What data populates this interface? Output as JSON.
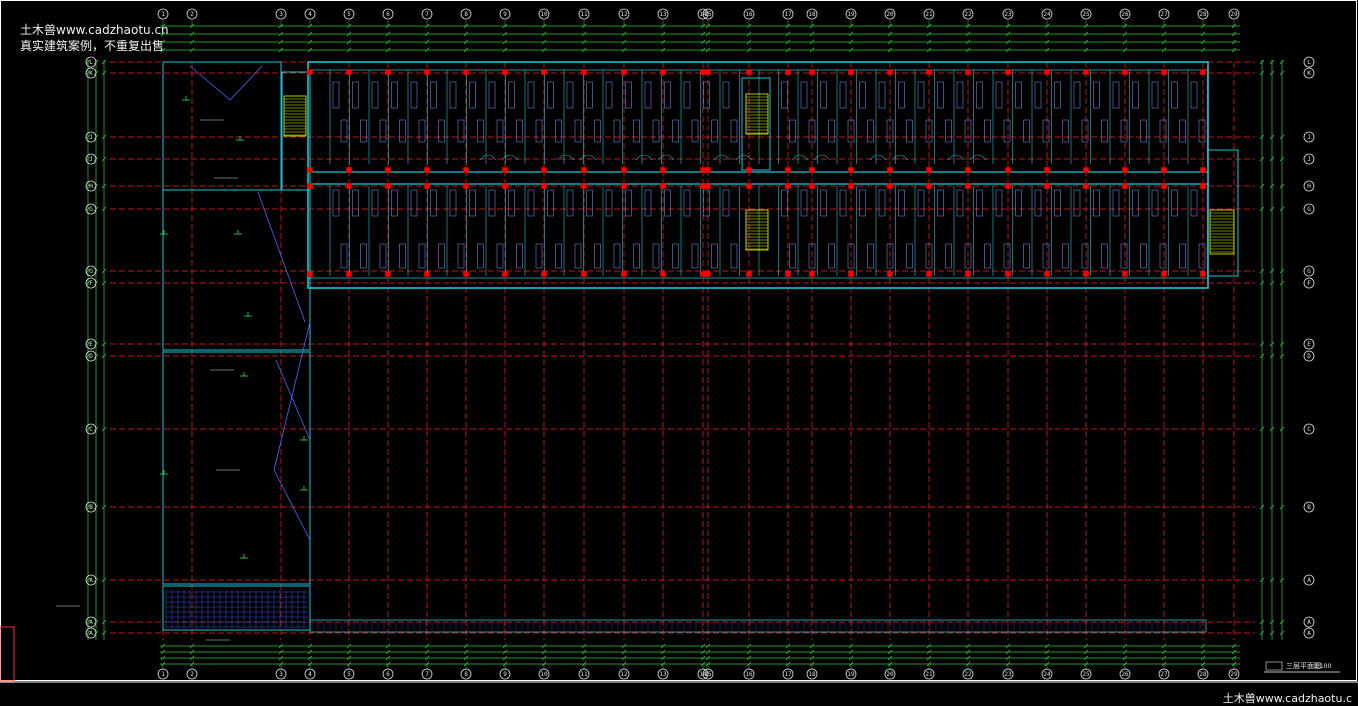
{
  "watermark": {
    "line1": "土木兽www.cadzhaotu.cn",
    "line2": "真实建筑案例，不重复出售",
    "footer": "土木兽www.cadzhaotu.c"
  },
  "grid": {
    "columns": [
      "1",
      "2",
      "3",
      "4",
      "5",
      "6",
      "7",
      "8",
      "9",
      "10",
      "11",
      "12",
      "13",
      "14",
      "15",
      "16",
      "17",
      "18",
      "19",
      "20",
      "21",
      "22",
      "23",
      "24",
      "25",
      "26",
      "27",
      "28",
      "29"
    ],
    "rows": [
      "L",
      "K",
      "J",
      "J",
      "H",
      "G",
      "G",
      "F",
      "E",
      "D",
      "C",
      "B",
      "A",
      "A",
      "A"
    ]
  },
  "drawing_title": {
    "main": "三层平面图",
    "scale": "1:100"
  },
  "colors": {
    "background": "#000000",
    "wall": "#19c6d8",
    "axis": "#ff2020",
    "dimension": "#2ecc40",
    "furniture": "#8a9bff",
    "stair": "#e6ff00",
    "column": "#ff0000",
    "text": "#ffffff"
  }
}
